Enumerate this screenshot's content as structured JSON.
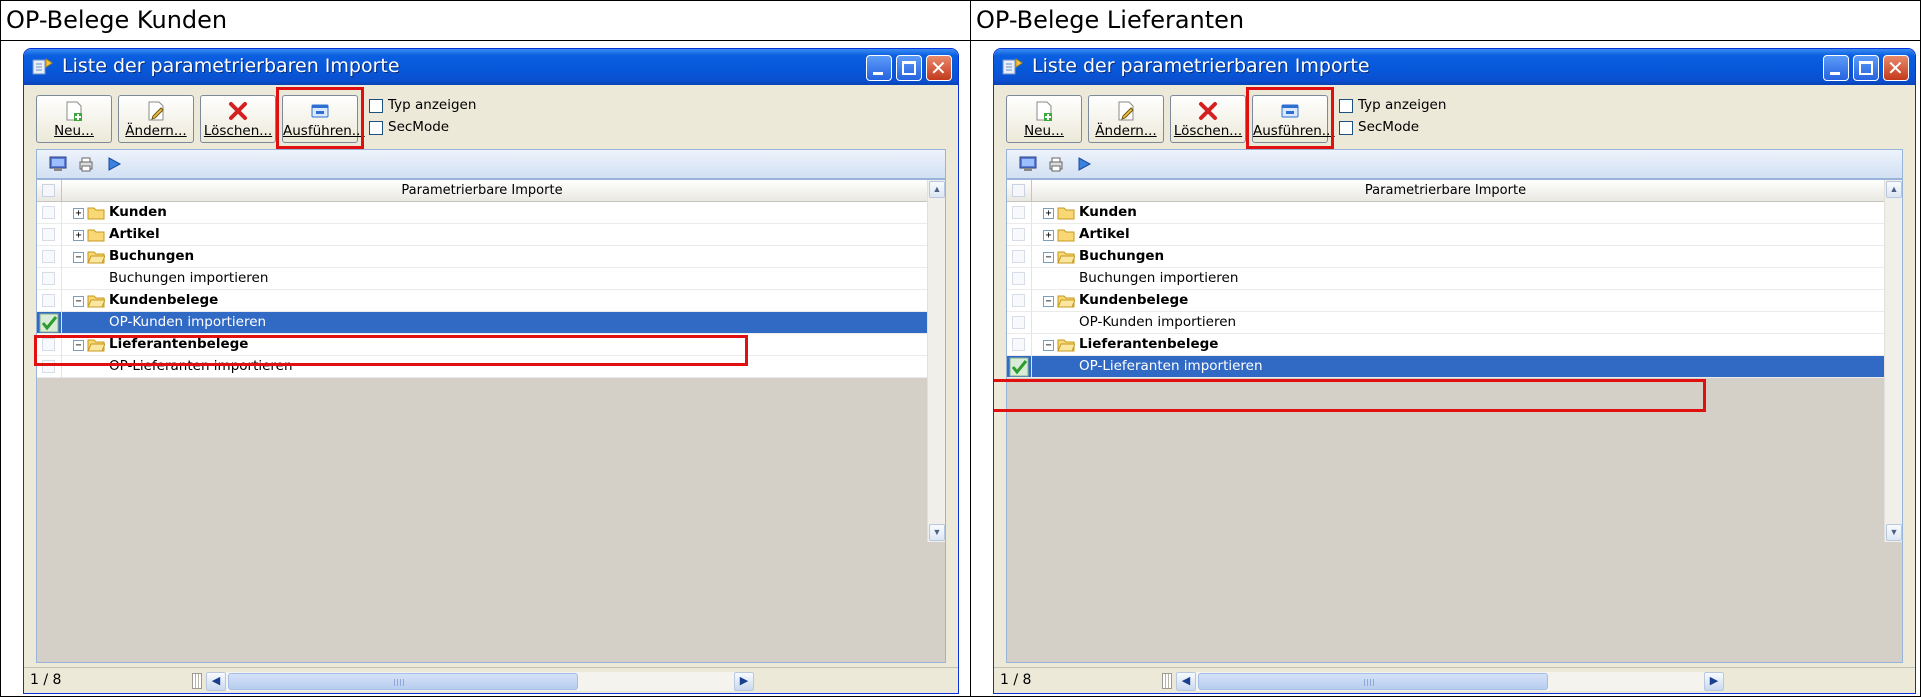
{
  "panels": [
    {
      "caption": "OP-Belege Kunden",
      "window": {
        "title": "Liste der parametrierbaren Importe",
        "toolbar": {
          "new": "Neu...",
          "edit": "Ändern...",
          "delete": "Löschen...",
          "run": "Ausführen...",
          "show_type": "Typ anzeigen",
          "secmode": "SecMode"
        },
        "grid": {
          "header": "Parametrierbare Importe",
          "rows": [
            {
              "label": "Kunden",
              "type": "group",
              "expanded": false,
              "selected": false
            },
            {
              "label": "Artikel",
              "type": "group",
              "expanded": false,
              "selected": false
            },
            {
              "label": "Buchungen",
              "type": "group",
              "expanded": true,
              "selected": false
            },
            {
              "label": "Buchungen importieren",
              "type": "item",
              "selected": false
            },
            {
              "label": "Kundenbelege",
              "type": "group",
              "expanded": true,
              "selected": false
            },
            {
              "label": "OP-Kunden importieren",
              "type": "item",
              "selected": true
            },
            {
              "label": "Lieferantenbelege",
              "type": "group",
              "expanded": true,
              "selected": false
            },
            {
              "label": "OP-Lieferanten importieren",
              "type": "item",
              "selected": false
            }
          ]
        },
        "status": {
          "page": "1 / 8"
        }
      }
    },
    {
      "caption": "OP-Belege Lieferanten",
      "window": {
        "title": "Liste der parametrierbaren Importe",
        "toolbar": {
          "new": "Neu...",
          "edit": "Ändern...",
          "delete": "Löschen...",
          "run": "Ausführen...",
          "show_type": "Typ anzeigen",
          "secmode": "SecMode"
        },
        "grid": {
          "header": "Parametrierbare Importe",
          "rows": [
            {
              "label": "Kunden",
              "type": "group",
              "expanded": false,
              "selected": false
            },
            {
              "label": "Artikel",
              "type": "group",
              "expanded": false,
              "selected": false
            },
            {
              "label": "Buchungen",
              "type": "group",
              "expanded": true,
              "selected": false
            },
            {
              "label": "Buchungen importieren",
              "type": "item",
              "selected": false
            },
            {
              "label": "Kundenbelege",
              "type": "group",
              "expanded": true,
              "selected": false
            },
            {
              "label": "OP-Kunden importieren",
              "type": "item",
              "selected": false
            },
            {
              "label": "Lieferantenbelege",
              "type": "group",
              "expanded": true,
              "selected": false
            },
            {
              "label": "OP-Lieferanten importieren",
              "type": "item",
              "selected": true
            }
          ]
        },
        "status": {
          "page": "1 / 8"
        }
      }
    }
  ],
  "colors": {
    "highlight_box": "#e01010",
    "selection": "#316ac5",
    "titlebar": "#0757d9",
    "check": "#2e9b2e"
  }
}
